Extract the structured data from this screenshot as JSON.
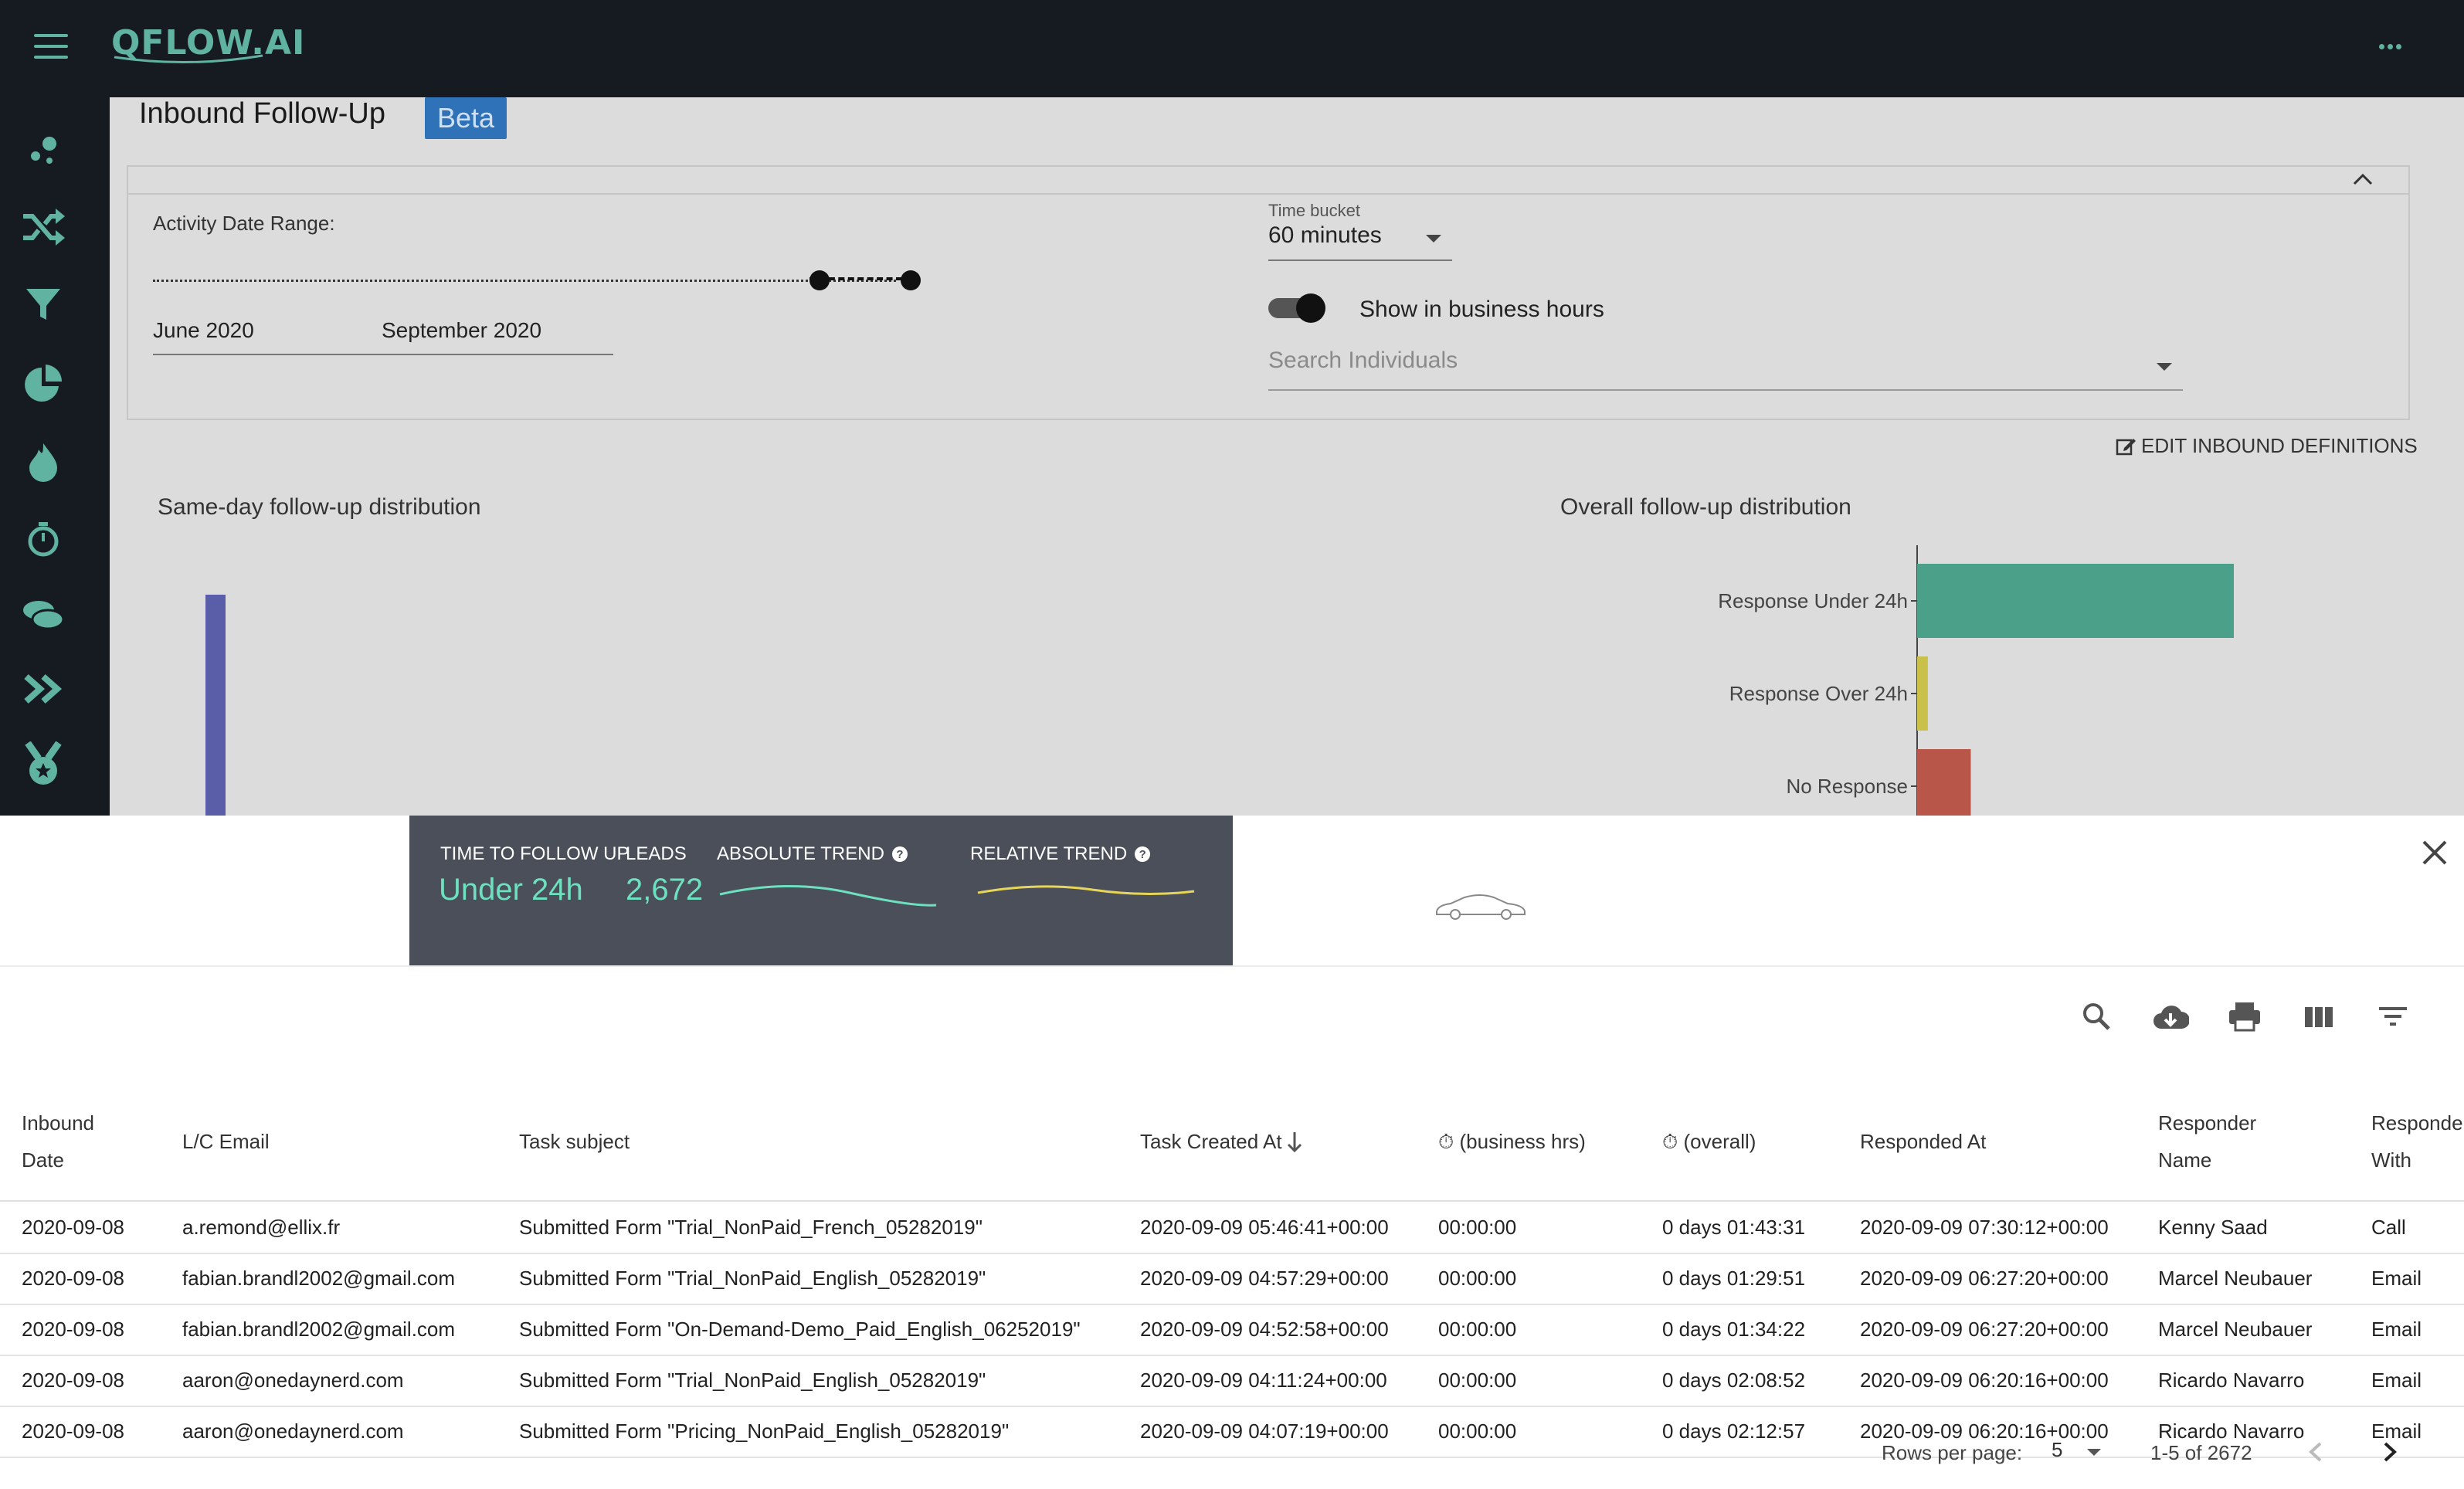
{
  "app": {
    "logo": "QFLOW.AI",
    "colors": {
      "accent": "#5fb3a0",
      "topbar": "#161b22",
      "beta": "#2f72b8",
      "kpi_bg": "#4a4f5a",
      "kpi_value": "#6fe0bf"
    }
  },
  "page": {
    "title": "Inbound Follow-Up",
    "badge": "Beta"
  },
  "sidebar": {
    "icons": [
      "nodes-icon",
      "shuffle-icon",
      "funnel-icon",
      "pie-chart-icon",
      "flame-icon",
      "stopwatch-icon",
      "coins-icon",
      "double-chevron-icon",
      "medal-icon"
    ]
  },
  "filters": {
    "date_range_label": "Activity Date Range:",
    "date_from": "June 2020",
    "date_to": "September 2020",
    "time_bucket_label": "Time bucket",
    "time_bucket_value": "60 minutes",
    "business_hours_label": "Show in business hours",
    "business_hours_on": true,
    "search_placeholder": "Search Individuals"
  },
  "edit_definitions": "EDIT INBOUND DEFINITIONS",
  "charts": {
    "left_title": "Same-day follow-up distribution",
    "right_title": "Overall follow-up distribution"
  },
  "chart_data": {
    "type": "bar",
    "orientation": "horizontal",
    "title": "Overall follow-up distribution",
    "categories": [
      "Response Under 24h",
      "Response Over 24h",
      "No Response"
    ],
    "values": [
      2672,
      80,
      400
    ],
    "colors": [
      "#4aa088",
      "#c9c14a",
      "#b8564a"
    ]
  },
  "kpi": {
    "time_label": "TIME TO FOLLOW UP",
    "time_value": "Under 24h",
    "leads_label": "LEADS",
    "leads_value": "2,672",
    "abs_trend_label": "ABSOLUTE TREND",
    "rel_trend_label": "RELATIVE TREND"
  },
  "table": {
    "columns": [
      "Inbound\nDate",
      "L/C Email",
      "Task subject",
      "Task Created At",
      "(business hrs)",
      "(overall)",
      "Responded At",
      "Responder\nName",
      "Responde\nWith"
    ],
    "rows": [
      [
        "2020-09-08",
        "a.remond@ellix.fr",
        "Submitted Form \"Trial_NonPaid_French_05282019\"",
        "2020-09-09 05:46:41+00:00",
        "00:00:00",
        "0 days 01:43:31",
        "2020-09-09 07:30:12+00:00",
        "Kenny Saad",
        "Call"
      ],
      [
        "2020-09-08",
        "fabian.brandl2002@gmail.com",
        "Submitted Form \"Trial_NonPaid_English_05282019\"",
        "2020-09-09 04:57:29+00:00",
        "00:00:00",
        "0 days 01:29:51",
        "2020-09-09 06:27:20+00:00",
        "Marcel Neubauer",
        "Email"
      ],
      [
        "2020-09-08",
        "fabian.brandl2002@gmail.com",
        "Submitted Form \"On-Demand-Demo_Paid_English_06252019\"",
        "2020-09-09 04:52:58+00:00",
        "00:00:00",
        "0 days 01:34:22",
        "2020-09-09 06:27:20+00:00",
        "Marcel Neubauer",
        "Email"
      ],
      [
        "2020-09-08",
        "aaron@onedaynerd.com",
        "Submitted Form \"Trial_NonPaid_English_05282019\"",
        "2020-09-09 04:11:24+00:00",
        "00:00:00",
        "0 days 02:08:52",
        "2020-09-09 06:20:16+00:00",
        "Ricardo Navarro",
        "Email"
      ],
      [
        "2020-09-08",
        "aaron@onedaynerd.com",
        "Submitted Form \"Pricing_NonPaid_English_05282019\"",
        "2020-09-09 04:07:19+00:00",
        "00:00:00",
        "0 days 02:12:57",
        "2020-09-09 06:20:16+00:00",
        "Ricardo Navarro",
        "Email"
      ]
    ]
  },
  "pagination": {
    "rows_per_page_label": "Rows per page:",
    "rows_per_page": "5",
    "range": "1-5 of 2672"
  }
}
